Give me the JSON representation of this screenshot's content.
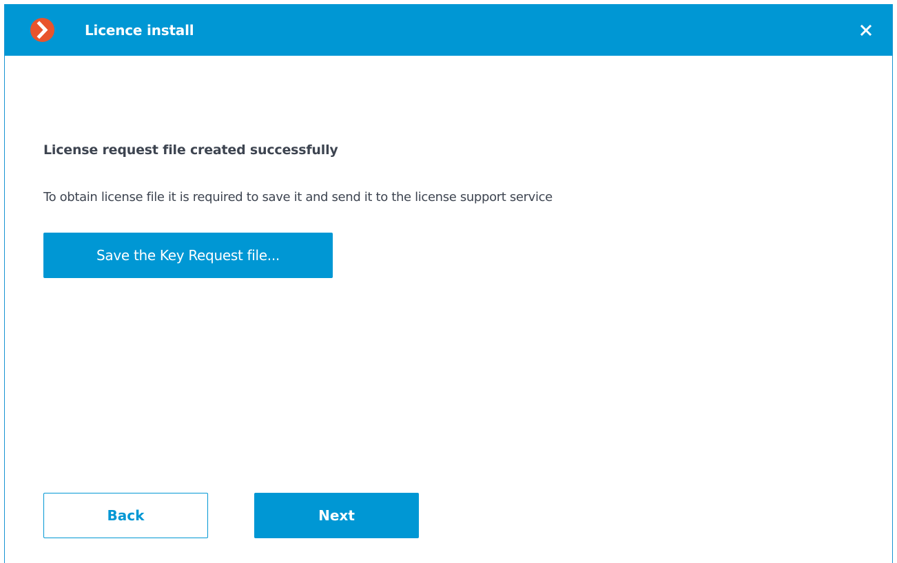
{
  "window": {
    "title": "Licence install",
    "app_icon": "chevron-right-icon",
    "close_icon": "close-icon"
  },
  "content": {
    "heading": "License request file created successfully",
    "description": "To obtain license file it is required to save it and send it to the license support service",
    "save_button_label": "Save the Key Request file..."
  },
  "footer": {
    "back_label": "Back",
    "next_label": "Next"
  },
  "colors": {
    "accent": "#0097d4",
    "app_icon_bg": "#e8542c",
    "text": "#3d4450"
  }
}
